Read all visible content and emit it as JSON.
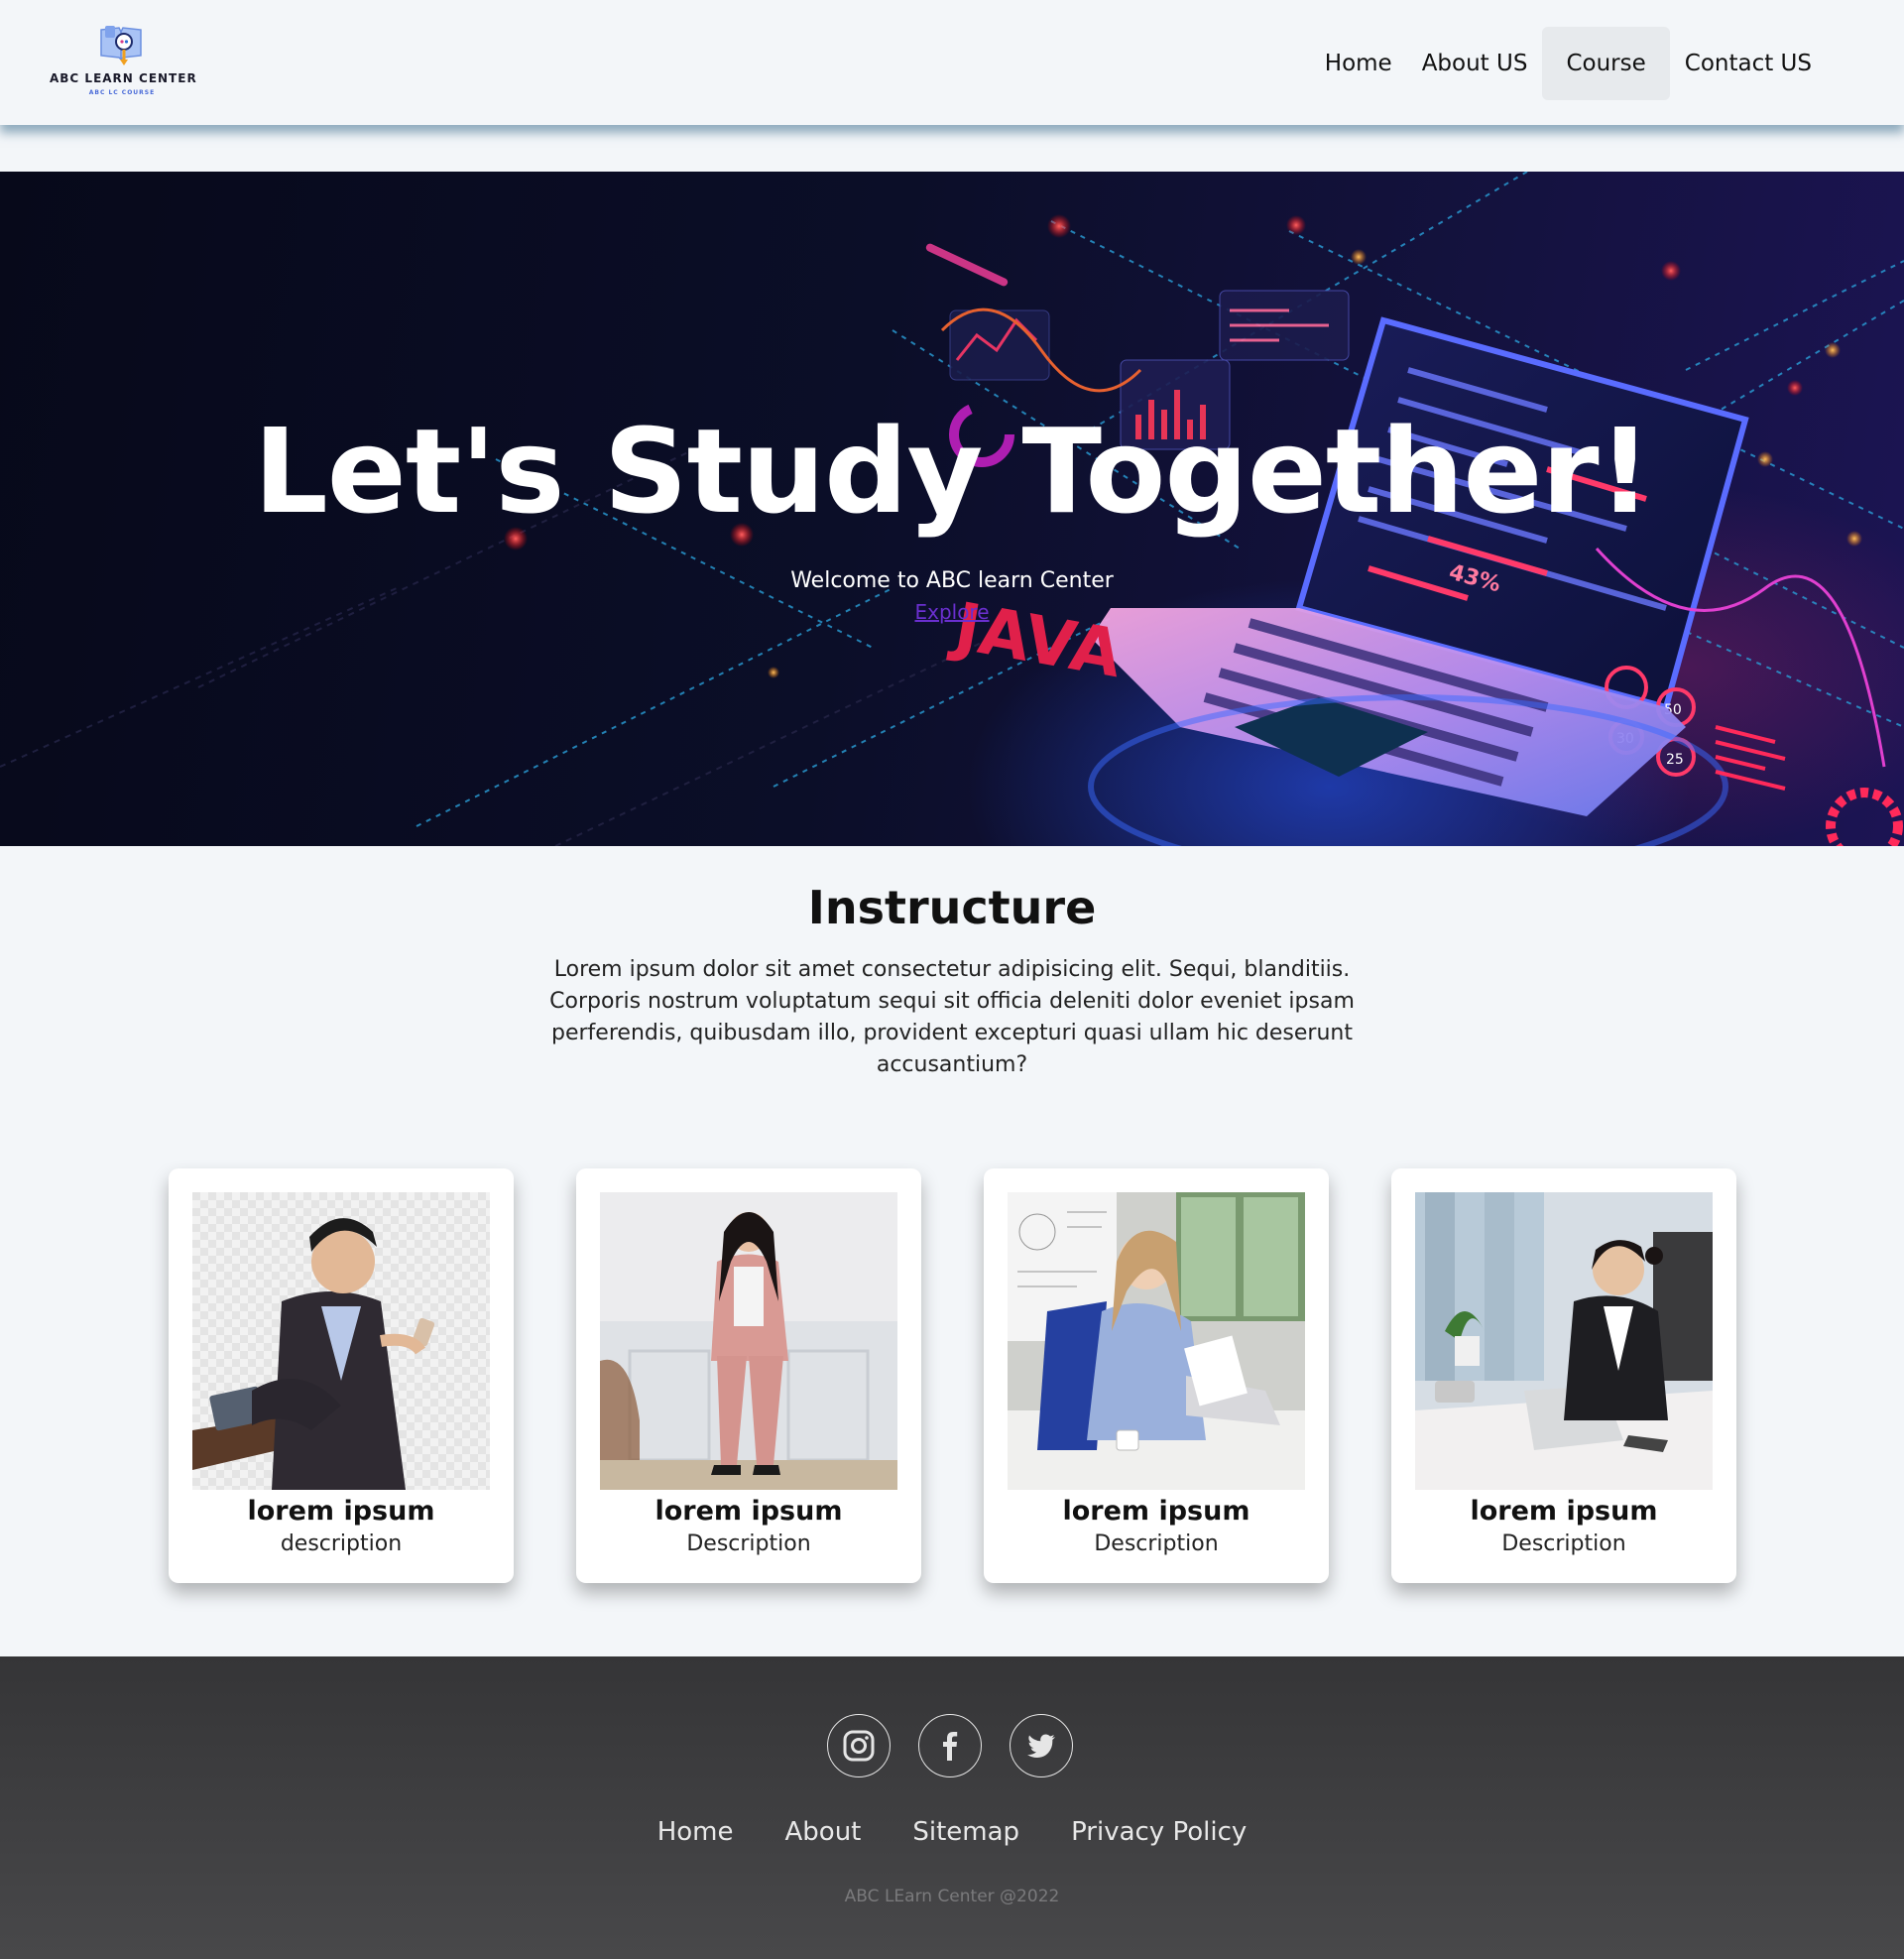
{
  "header": {
    "logo_title": "ABC LEARN CENTER",
    "logo_subtitle": "ABC LC COURSE",
    "nav": [
      {
        "label": "Home"
      },
      {
        "label": "About US"
      },
      {
        "label": "Course",
        "active": true
      },
      {
        "label": "Contact US"
      }
    ]
  },
  "hero": {
    "title": "Let's Study Together!",
    "subtitle": "Welcome to ABC learn Center",
    "link": "Explore",
    "background_image_text": [
      "JAVA",
      "43%",
      "50",
      "25",
      "30"
    ]
  },
  "instructure": {
    "title": "Instructure",
    "text": "Lorem ipsum dolor sit amet consectetur adipisicing elit. Sequi, blanditiis. Corporis nostrum voluptatum sequi sit officia deleniti dolor eveniet ipsam perferendis, quibusdam illo, provident excepturi quasi ullam hic deserunt accusantium?"
  },
  "cards": [
    {
      "title": "lorem ipsum",
      "description": "description",
      "photo": "man-in-suit-with-phone"
    },
    {
      "title": "lorem ipsum",
      "description": "Description",
      "photo": "woman-in-pink-suit"
    },
    {
      "title": "lorem ipsum",
      "description": "Description",
      "photo": "woman-at-laptop-with-papers"
    },
    {
      "title": "lorem ipsum",
      "description": "Description",
      "photo": "businesswoman-at-desk"
    }
  ],
  "footer": {
    "social": [
      "instagram-icon",
      "facebook-icon",
      "twitter-icon"
    ],
    "links": [
      "Home",
      "About",
      "Sitemap",
      "Privacy Policy"
    ],
    "copyright": "ABC LEarn Center @2022"
  },
  "colors": {
    "page_bg": "#f3f6f9",
    "hero_bg": "#0b0e28",
    "link_purple": "#6a2fcf",
    "footer_bg": "#3c3c3e",
    "footer_text": "#e8e8e8"
  }
}
